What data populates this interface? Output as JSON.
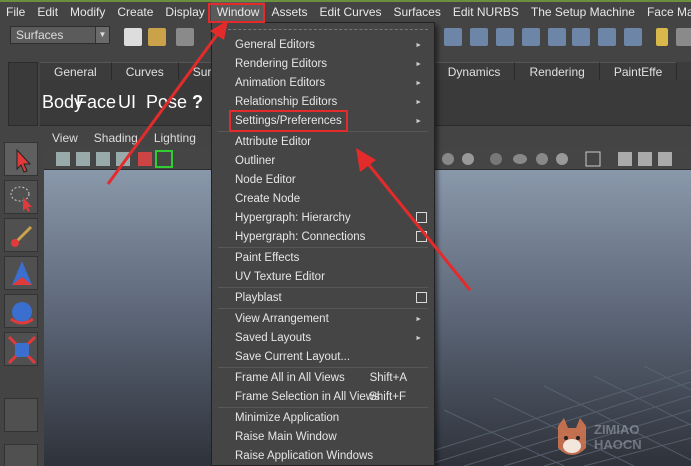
{
  "menubar": {
    "items": [
      "File",
      "Edit",
      "Modify",
      "Create",
      "Display",
      "Window",
      "Assets",
      "Edit Curves",
      "Surfaces",
      "Edit NURBS",
      "The Setup Machine",
      "Face Machine"
    ]
  },
  "mode_selector": {
    "value": "Surfaces"
  },
  "shelf_tabs": [
    "General",
    "Curves",
    "Surfac",
    "mation",
    "Dynamics",
    "Rendering",
    "PaintEffe"
  ],
  "shelf_buttons": [
    "Body",
    "Face",
    "UI",
    "Pose",
    "?"
  ],
  "panel_menu": [
    "View",
    "Shading",
    "Lighting",
    "Sho"
  ],
  "window_menu": {
    "items": [
      {
        "label": "General Editors",
        "submenu": true
      },
      {
        "label": "Rendering Editors",
        "submenu": true
      },
      {
        "label": "Animation Editors",
        "submenu": true
      },
      {
        "label": "Relationship Editors",
        "submenu": true
      },
      {
        "label": "Settings/Preferences",
        "submenu": true
      },
      {
        "label": "Attribute Editor"
      },
      {
        "label": "Outliner"
      },
      {
        "label": "Node Editor"
      },
      {
        "label": "Create Node"
      },
      {
        "label": "Hypergraph: Hierarchy",
        "option_box": true
      },
      {
        "label": "Hypergraph: Connections",
        "option_box": true
      },
      {
        "label": "Paint Effects"
      },
      {
        "label": "UV Texture Editor"
      },
      {
        "label": "Playblast",
        "option_box": true
      },
      {
        "label": "View Arrangement",
        "submenu": true
      },
      {
        "label": "Saved Layouts",
        "submenu": true
      },
      {
        "label": "Save Current Layout..."
      },
      {
        "label": "Frame All in All Views",
        "shortcut": "Shift+A"
      },
      {
        "label": "Frame Selection in All Views",
        "shortcut": "Shift+F"
      },
      {
        "label": "Minimize Application"
      },
      {
        "label": "Raise Main Window"
      },
      {
        "label": "Raise Application Windows"
      }
    ]
  },
  "colors": {
    "highlight": "#e32b2b",
    "menu_bg": "#454545",
    "top_accent": "#6b8f3d"
  },
  "icons": [
    "select-tool-icon",
    "lasso-tool-icon",
    "paint-tool-icon",
    "move-tool-icon",
    "rotate-tool-icon",
    "scale-tool-icon",
    "submenu-arrow-icon",
    "option-box-icon"
  ]
}
